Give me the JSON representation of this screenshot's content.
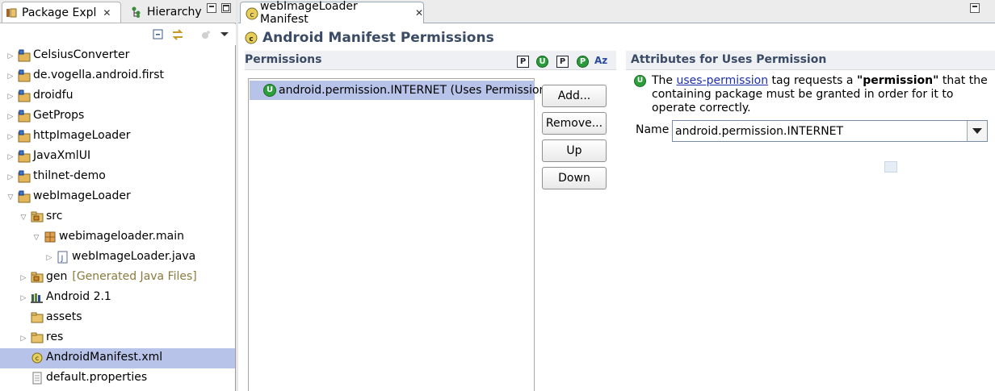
{
  "left_panel": {
    "tab_package_explorer": "Package Expl",
    "tab_hierarchy": "Hierarchy",
    "tree": [
      {
        "label": "CelsiusConverter",
        "indent": 0,
        "expander": "collapsed",
        "icon": "project-icon"
      },
      {
        "label": "de.vogella.android.first",
        "indent": 0,
        "expander": "collapsed",
        "icon": "project-icon"
      },
      {
        "label": "droidfu",
        "indent": 0,
        "expander": "collapsed",
        "icon": "project-icon"
      },
      {
        "label": "GetProps",
        "indent": 0,
        "expander": "collapsed",
        "icon": "project-icon"
      },
      {
        "label": "httpImageLoader",
        "indent": 0,
        "expander": "collapsed",
        "icon": "project-icon"
      },
      {
        "label": "JavaXmlUI",
        "indent": 0,
        "expander": "collapsed",
        "icon": "project-icon"
      },
      {
        "label": "thilnet-demo",
        "indent": 0,
        "expander": "collapsed",
        "icon": "project-icon"
      },
      {
        "label": "webImageLoader",
        "indent": 0,
        "expander": "expanded",
        "icon": "project-icon"
      },
      {
        "label": "src",
        "indent": 1,
        "expander": "expanded",
        "icon": "source-folder-icon"
      },
      {
        "label": "webimageloader.main",
        "indent": 2,
        "expander": "expanded",
        "icon": "package-icon"
      },
      {
        "label": "webImageLoader.java",
        "indent": 3,
        "expander": "collapsed",
        "icon": "java-file-icon"
      },
      {
        "label": "gen",
        "extra": "[Generated Java Files]",
        "indent": 1,
        "expander": "collapsed",
        "icon": "source-folder-icon"
      },
      {
        "label": "Android 2.1",
        "indent": 1,
        "expander": "collapsed",
        "icon": "library-icon"
      },
      {
        "label": "assets",
        "indent": 1,
        "expander": "none",
        "icon": "folder-icon"
      },
      {
        "label": "res",
        "indent": 1,
        "expander": "collapsed",
        "icon": "folder-icon"
      },
      {
        "label": "AndroidManifest.xml",
        "indent": 1,
        "expander": "none",
        "icon": "manifest-icon",
        "selected": true
      },
      {
        "label": "default.properties",
        "indent": 1,
        "expander": "none",
        "icon": "properties-file-icon"
      }
    ]
  },
  "editor": {
    "tab_label": "webImageLoader Manifest",
    "page_title": "Android Manifest Permissions",
    "permissions_section": {
      "title": "Permissions",
      "header_buttons": [
        "P",
        "U",
        "P",
        "P",
        "Az"
      ],
      "items": [
        {
          "label": "android.permission.INTERNET (Uses Permission)",
          "badge": "U"
        }
      ],
      "buttons": {
        "add": "Add...",
        "remove": "Remove...",
        "up": "Up",
        "down": "Down"
      }
    },
    "attributes_section": {
      "title": "Attributes for Uses Permission",
      "description_pre": "The ",
      "description_link": "uses-permission",
      "description_mid": " tag requests a ",
      "description_bold": "\"permission\"",
      "description_post": " that the containing package must be granted in order for it to operate correctly.",
      "name_label": "Name",
      "name_value": "android.permission.INTERNET"
    }
  },
  "colors": {
    "selection": "#b7c3e8",
    "section_title": "#3b4b66",
    "link": "#1c2fa8",
    "badge_green": "#2ba03a"
  }
}
